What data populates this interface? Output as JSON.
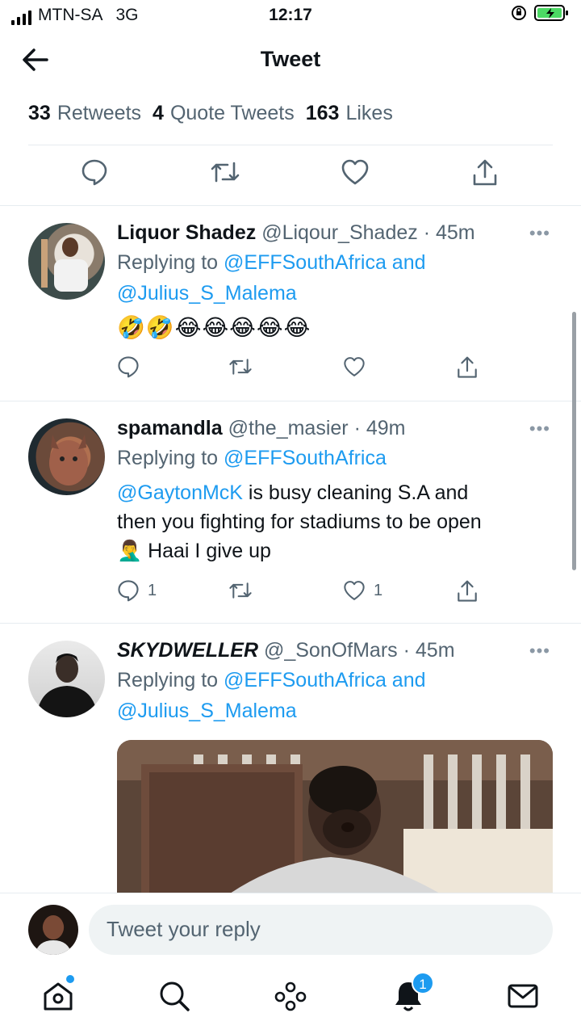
{
  "status_bar": {
    "carrier": "MTN-SA",
    "network": "3G",
    "time": "12:17"
  },
  "header": {
    "title": "Tweet"
  },
  "stats": {
    "retweets_count": "33",
    "retweets_label": "Retweets",
    "quotes_count": "4",
    "quotes_label": "Quote Tweets",
    "likes_count": "163",
    "likes_label": "Likes"
  },
  "replies": [
    {
      "name": "Liquor Shadez",
      "handle": "@Liqour_Shadez",
      "time": "· 45m",
      "replying_prefix": "Replying to",
      "replying_to": "@EFFSouthAfrica and",
      "replying_to_2": "@Julius_S_Malema",
      "text": "🤣🤣😂😂😂😂😂",
      "reply_count": "",
      "like_count": ""
    },
    {
      "name": "spamandla",
      "handle": "@the_masier",
      "time": "· 49m",
      "replying_prefix": "Replying to",
      "replying_to": "@EFFSouthAfrica",
      "mention": "@GaytonMcK",
      "text_1": " is busy cleaning S.A and",
      "text_2": "then you fighting for stadiums to be open",
      "text_3": "🤦‍♂️ Haai I give up",
      "reply_count": "1",
      "like_count": "1"
    },
    {
      "name": "SKYDWELLER",
      "handle": "@_SonOfMars",
      "time": "· 45m",
      "replying_prefix": "Replying to",
      "replying_to": "@EFFSouthAfrica and",
      "replying_to_2": "@Julius_S_Malema"
    }
  ],
  "reply_bar": {
    "placeholder": "Tweet your reply"
  },
  "tab_bar": {
    "notifications_badge": "1"
  },
  "colors": {
    "accent": "#1d9bf0",
    "text": "#0f1419",
    "secondary": "#536471"
  }
}
